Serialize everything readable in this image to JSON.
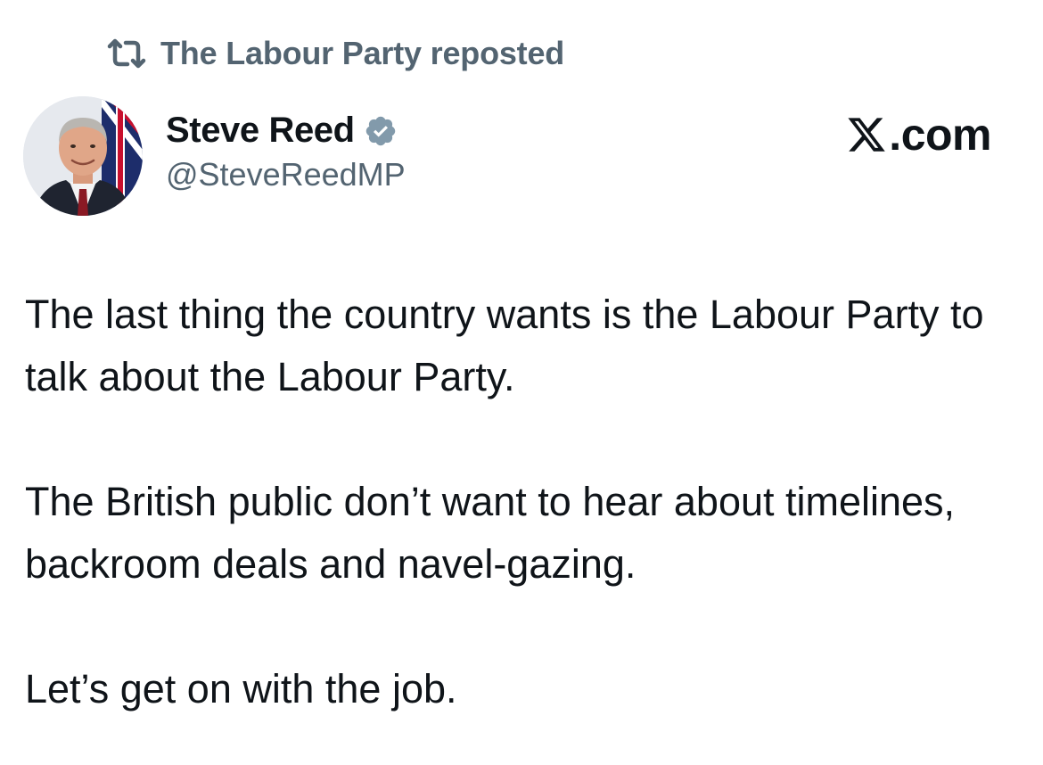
{
  "repost": {
    "icon": "repost-icon",
    "text": "The Labour Party reposted"
  },
  "author": {
    "avatar_icon": "avatar",
    "display_name": "Steve Reed",
    "verified_icon": "verified-badge-icon",
    "handle": "@SteveReedMP"
  },
  "watermark": {
    "logo_icon": "x-logo-icon",
    "text": ".com"
  },
  "tweet": {
    "paragraphs": [
      "The last thing the country wants is the Labour Party to talk about the Labour Party.",
      "The British public don’t want to hear about timelines, backroom deals and navel-gazing.",
      "Let’s get on with the job."
    ]
  },
  "colors": {
    "text_primary": "#0f1419",
    "text_secondary": "#536471",
    "verified_badge": "#829aab",
    "background": "#ffffff"
  }
}
